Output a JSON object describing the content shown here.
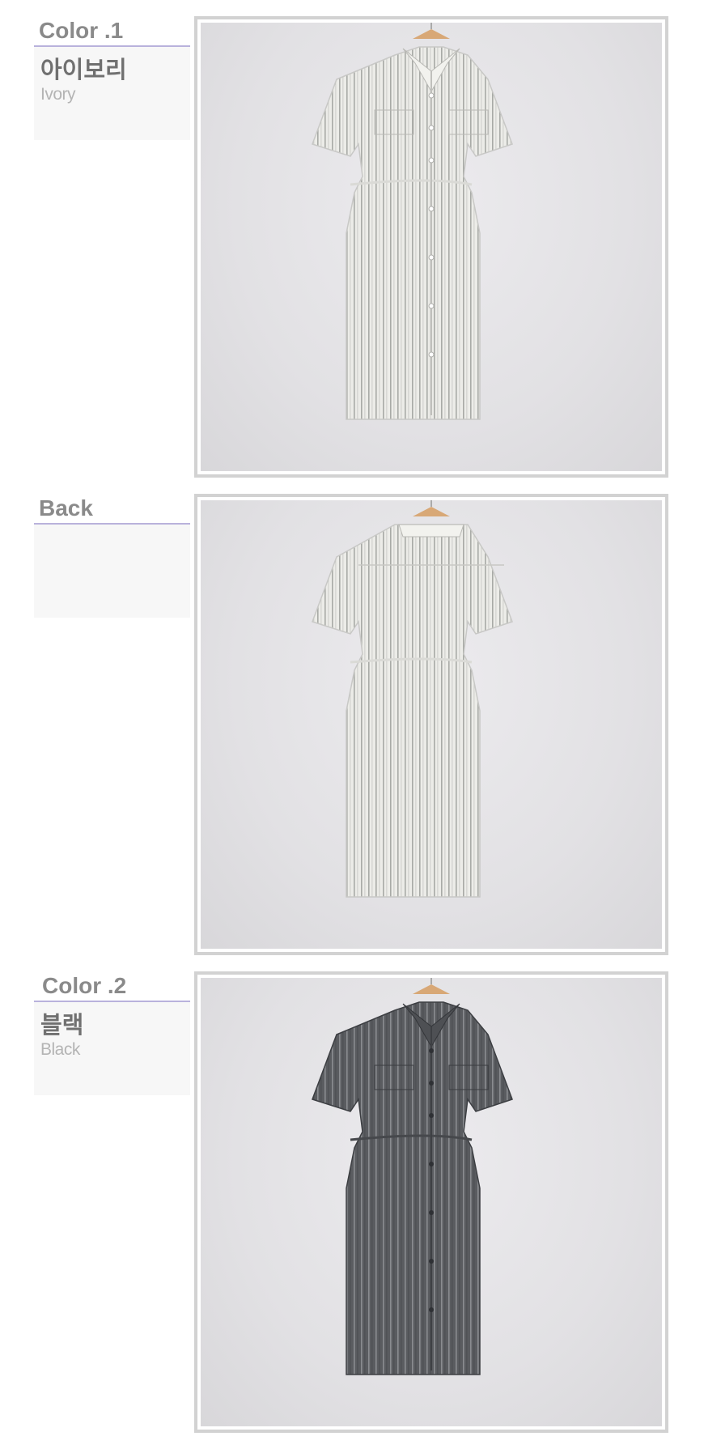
{
  "sections": [
    {
      "id": "color-1",
      "title": "Color .1",
      "name_kr": "아이보리",
      "name_en": "Ivory"
    },
    {
      "id": "back",
      "title": "Back",
      "name_kr": "",
      "name_en": ""
    },
    {
      "id": "color-2",
      "title": "Color .2",
      "name_kr": "블랙",
      "name_en": "Black"
    }
  ],
  "colors": {
    "label_underline": "#b9b2dc",
    "label_bg": "#f7f7f7",
    "frame_border": "#d2d2d2",
    "ivory_dress": "#ecece8",
    "ivory_stripe": "#a8aaa6",
    "black_dress": "#5a5c60",
    "black_stripe": "#8a8c90",
    "hanger": "#d8a876"
  }
}
